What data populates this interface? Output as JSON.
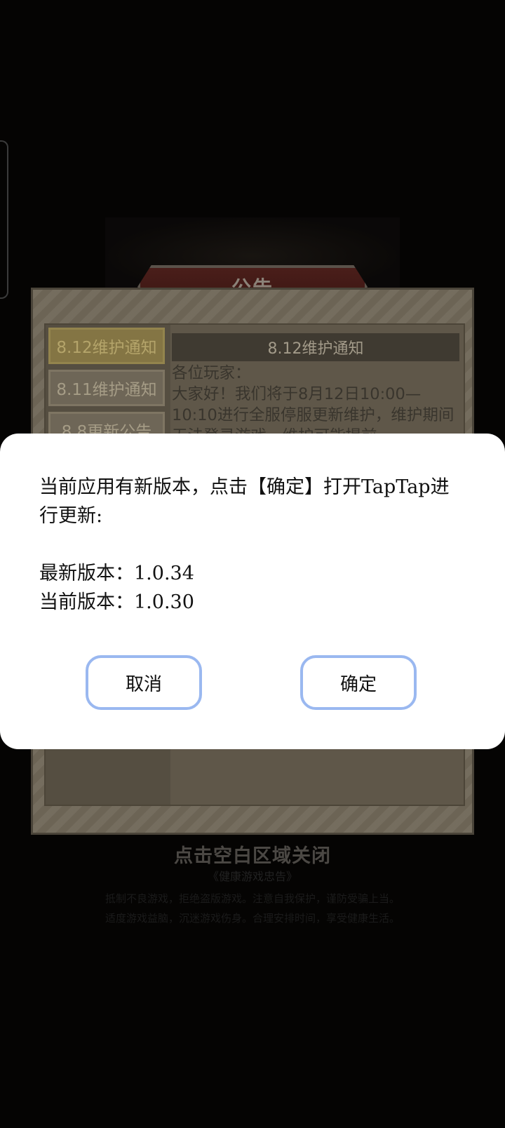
{
  "notice": {
    "header": "公告",
    "tabs": [
      {
        "label": "8.12维护通知",
        "active": true
      },
      {
        "label": "8.11维护通知",
        "active": false
      },
      {
        "label": "8.8更新公告",
        "active": false
      }
    ],
    "content_title": "8.12维护通知",
    "content_body": "各位玩家：\n大家好！我们将于8月12日10:00—10:10进行全服停服更新维护，维护期间无法登录游戏，维护可能提前"
  },
  "close_hint": "点击空白区域关闭",
  "health_notice": {
    "title": "《健康游戏忠告》",
    "lines": [
      "抵制不良游戏，拒绝盗版游戏。注意自我保护，谨防受骗上当。",
      "适度游戏益脑，沉迷游戏伤身。合理安排时间，享受健康生活。"
    ]
  },
  "update_dialog": {
    "message": "当前应用有新版本，点击【确定】打开TapTap进行更新:",
    "latest_version_label": "最新版本：",
    "latest_version": "1.0.34",
    "current_version_label": "当前版本：",
    "current_version": "1.0.30",
    "cancel_label": "取消",
    "confirm_label": "确定"
  },
  "colors": {
    "button_border": "#9ab8f0",
    "modal_bg": "#ffffff",
    "backdrop": "#050403"
  }
}
